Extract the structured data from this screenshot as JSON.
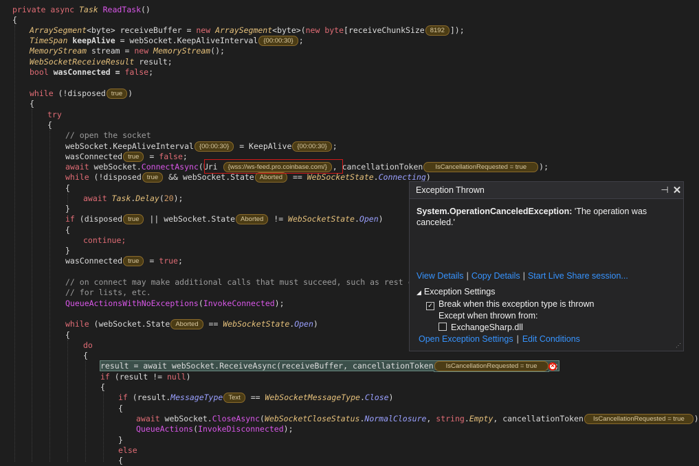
{
  "code": {
    "l1": {
      "mod1": "private",
      "mod2": "async",
      "type": "Task",
      "name": "ReadTask",
      "rest": "()"
    },
    "l2": "{",
    "l3": {
      "t1": "ArraySegment",
      "a": "<byte>",
      "v": " receiveBuffer = ",
      "k": "new",
      "t2": "ArraySegment",
      "a2": "<byte>(",
      "k2": "new",
      "b": " byte",
      "c": "[receiveChunkSize",
      "tip": "8192",
      "e": "]);"
    },
    "l4": {
      "t": "TimeSpan",
      "v": " keepAlive",
      "m": " = webSocket.",
      "p": "KeepAliveInterval",
      "tip": "{00:00:30}",
      "e": ";"
    },
    "l5": {
      "t": "MemoryStream",
      "v": " stream = ",
      "k": "new",
      "t2": " MemoryStream",
      "e": "();"
    },
    "l6": {
      "t": "WebSocketReceiveResult",
      "v": " result;"
    },
    "l7": {
      "t": "bool",
      "v": " wasConnected = ",
      "k": "false",
      "e": ";"
    },
    "l8": {
      "k": "while",
      "a": " (!disposed",
      "tip": "true",
      "e": ")"
    },
    "l9": "{",
    "l10": "try",
    "l11": "{",
    "l12": "// open the socket",
    "l13": {
      "a": "webSocket.KeepAliveInterval",
      "tip1": "{00:00:30}",
      "b": "= KeepAlive",
      "tip2": "{00:00:30}",
      "e": ";"
    },
    "l14": {
      "a": "wasConnected",
      "tip": "true",
      "b": "= ",
      "k": "false",
      "e": ";"
    },
    "l15": {
      "k": "await",
      "a": " webSocket.",
      "f": "ConnectAsync",
      "b": "(Uri",
      "tip1": "{wss://ws-feed.pro.coinbase.com/}",
      "c": ", cancellationToken",
      "tip2": "IsCancellationRequested = true",
      "e": ");"
    },
    "l16": {
      "k": "while",
      "a": " (!disposed",
      "tip1": "true",
      "b": "&& webSocket.State",
      "tip2": "Aborted",
      "c": "== ",
      "t": "WebSocketState",
      "d": ".",
      "p": "Connecting",
      "e": ")"
    },
    "l17": "{",
    "l18": {
      "k": "await",
      "t": " Task",
      "d": ".",
      "f": "Delay",
      "a": "(",
      "n": "20",
      "e": ");"
    },
    "l19": "}",
    "l20": {
      "k": "if",
      "a": " (disposed",
      "tip1": "true",
      "b": "|| webSocket.State",
      "tip2": "Aborted",
      "c": "!= ",
      "t": "WebSocketState",
      "d": ".",
      "p": "Open",
      "e": ")"
    },
    "l21": "{",
    "l22": "continue;",
    "l23": "}",
    "l24": {
      "a": "wasConnected",
      "tip": "true",
      "b": "= ",
      "k": "true",
      "e": ";"
    },
    "l25": "// on connect may make additional calls that must succeed, such as rest calls",
    "l26": "// for lists, etc.",
    "l27": {
      "f": "QueueActionsWithNoExceptions",
      "a": "(",
      "f2": "InvokeConnected",
      "e": ");"
    },
    "l28": {
      "k": "while",
      "a": " (webSocket.State",
      "tip": "Aborted",
      "c": "== ",
      "t": "WebSocketState",
      "d": ".",
      "p": "Open",
      "e": ")"
    },
    "l29": "{",
    "l30": "do",
    "l31": "{",
    "l32": {
      "a": "result = await webSocket.ReceiveAsync(receiveBuffer, cancellationToken",
      "tip": "IsCancellationRequested = true",
      "e": ");"
    },
    "l33": {
      "k": "if",
      "a": " (result != ",
      "k2": "null",
      "e": ")"
    },
    "l34": "{",
    "l35": {
      "k": "if",
      "a": " (result.",
      "p": "MessageType",
      "tip": "Text",
      "c": "== ",
      "t": "WebSocketMessageType",
      "d": ".",
      "p2": "Close",
      "e": ")"
    },
    "l36": "{",
    "l37": {
      "k": "await",
      "a": " webSocket.",
      "f": "CloseAsync",
      "b": "(",
      "t": "WebSocketCloseStatus",
      "d": ".",
      "p": "NormalClosure",
      "c": ", ",
      "k2": "string",
      "d2": ".",
      "p2": "Empty",
      "e1": ", cancellationToken",
      "tip": "IsCancellationRequested = true",
      "e": ");"
    },
    "l38": {
      "f": "QueueActions",
      "a": "(",
      "f2": "InvokeDisconnected",
      "e": ");"
    },
    "l39": "}",
    "l40": "else",
    "l41": "{"
  },
  "exception": {
    "title": "Exception Thrown",
    "type": "System.OperationCanceledException:",
    "message": " 'The operation was canceled.'",
    "links": [
      "View Details",
      "Copy Details",
      "Start Live Share session..."
    ],
    "settings_header": "Exception Settings",
    "break_label": "Break when this exception type is thrown",
    "break_checked": true,
    "except_label": "Except when thrown from:",
    "module_label": "ExchangeSharp.dll",
    "module_checked": false,
    "footer_links": [
      "Open Exception Settings",
      "Edit Conditions"
    ],
    "pin_icon": "pin-icon",
    "close_icon": "close-icon"
  }
}
